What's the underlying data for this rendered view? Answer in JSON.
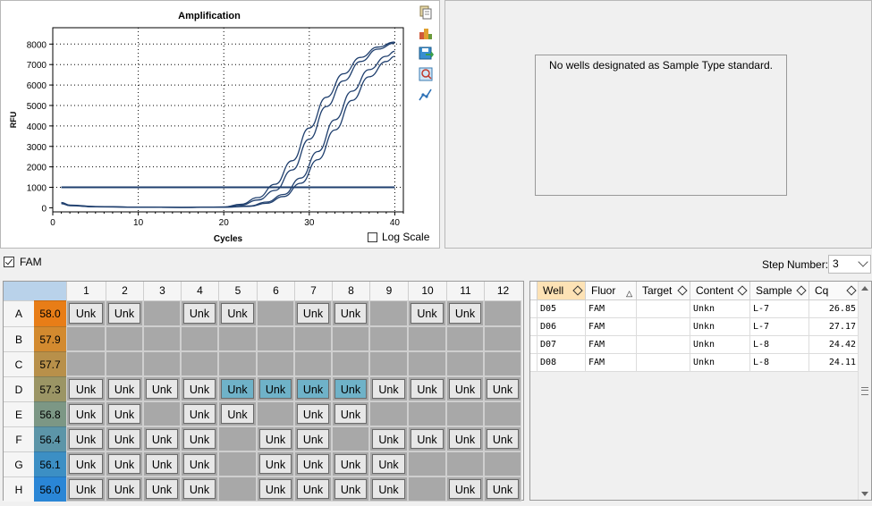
{
  "chart": {
    "title": "Amplification",
    "xlabel": "Cycles",
    "ylabel": "RFU",
    "xticks": [
      0,
      10,
      20,
      30,
      40
    ],
    "yticks": [
      0,
      1000,
      2000,
      3000,
      4000,
      5000,
      6000,
      7000,
      8000
    ],
    "log_scale_label": "Log Scale",
    "log_scale_checked": false
  },
  "chart_data": {
    "type": "line",
    "title": "Amplification",
    "xlabel": "Cycles",
    "ylabel": "RFU",
    "xlim": [
      0,
      41
    ],
    "ylim": [
      -200,
      8800
    ],
    "threshold": 1000,
    "grid": true,
    "series": [
      {
        "well": "D05",
        "values": [
          [
            1,
            260
          ],
          [
            2,
            130
          ],
          [
            5,
            60
          ],
          [
            10,
            30
          ],
          [
            15,
            20
          ],
          [
            20,
            40
          ],
          [
            22,
            170
          ],
          [
            24,
            500
          ],
          [
            26,
            1150
          ],
          [
            28,
            2300
          ],
          [
            30,
            3900
          ],
          [
            32,
            5400
          ],
          [
            34,
            6550
          ],
          [
            36,
            7350
          ],
          [
            38,
            7850
          ],
          [
            40,
            8100
          ]
        ]
      },
      {
        "well": "D06",
        "values": [
          [
            1,
            240
          ],
          [
            2,
            120
          ],
          [
            5,
            55
          ],
          [
            10,
            30
          ],
          [
            15,
            20
          ],
          [
            20,
            40
          ],
          [
            22,
            130
          ],
          [
            24,
            380
          ],
          [
            26,
            850
          ],
          [
            28,
            1850
          ],
          [
            30,
            3350
          ],
          [
            32,
            4950
          ],
          [
            34,
            6200
          ],
          [
            36,
            7150
          ],
          [
            38,
            7750
          ],
          [
            40,
            8050
          ]
        ]
      },
      {
        "well": "D07",
        "values": [
          [
            1,
            200
          ],
          [
            2,
            100
          ],
          [
            5,
            50
          ],
          [
            10,
            30
          ],
          [
            15,
            20
          ],
          [
            20,
            25
          ],
          [
            23,
            70
          ],
          [
            25,
            220
          ],
          [
            27,
            550
          ],
          [
            29,
            1200
          ],
          [
            31,
            2350
          ],
          [
            33,
            3800
          ],
          [
            35,
            5250
          ],
          [
            37,
            6400
          ],
          [
            39,
            7150
          ],
          [
            40,
            7400
          ]
        ]
      },
      {
        "well": "D08",
        "values": [
          [
            1,
            220
          ],
          [
            2,
            110
          ],
          [
            5,
            50
          ],
          [
            10,
            30
          ],
          [
            15,
            20
          ],
          [
            20,
            25
          ],
          [
            23,
            90
          ],
          [
            25,
            280
          ],
          [
            27,
            650
          ],
          [
            29,
            1450
          ],
          [
            31,
            2750
          ],
          [
            33,
            4300
          ],
          [
            35,
            5700
          ],
          [
            37,
            6750
          ],
          [
            39,
            7400
          ],
          [
            40,
            7650
          ]
        ]
      }
    ]
  },
  "std_curve": {
    "message": "No wells designated as Sample Type standard."
  },
  "fluor": {
    "label": "FAM",
    "checked": true
  },
  "step": {
    "label": "Step Number:",
    "value": "3"
  },
  "plate": {
    "columns": [
      "1",
      "2",
      "3",
      "4",
      "5",
      "6",
      "7",
      "8",
      "9",
      "10",
      "11",
      "12"
    ],
    "rows": [
      {
        "label": "A",
        "temp": "58.0",
        "color": "#e87d17",
        "wells": [
          "Unk",
          "Unk",
          "",
          "Unk",
          "Unk",
          "",
          "Unk",
          "Unk",
          "",
          "Unk",
          "Unk",
          ""
        ]
      },
      {
        "label": "B",
        "temp": "57.9",
        "color": "#d38a2f",
        "wells": [
          "",
          "",
          "",
          "",
          "",
          "",
          "",
          "",
          "",
          "",
          "",
          ""
        ]
      },
      {
        "label": "C",
        "temp": "57.7",
        "color": "#b8904a",
        "wells": [
          "",
          "",
          "",
          "",
          "",
          "",
          "",
          "",
          "",
          "",
          "",
          ""
        ]
      },
      {
        "label": "D",
        "temp": "57.3",
        "color": "#9b9565",
        "wells": [
          "Unk",
          "Unk",
          "Unk",
          "Unk",
          "Unk",
          "Unk",
          "Unk",
          "Unk",
          "Unk",
          "Unk",
          "Unk",
          "Unk"
        ],
        "selected": [
          4,
          5,
          6,
          7
        ]
      },
      {
        "label": "E",
        "temp": "56.8",
        "color": "#7c9785",
        "wells": [
          "Unk",
          "Unk",
          "",
          "Unk",
          "Unk",
          "",
          "Unk",
          "Unk",
          "",
          "",
          "",
          ""
        ]
      },
      {
        "label": "F",
        "temp": "56.4",
        "color": "#5c95a8",
        "wells": [
          "Unk",
          "Unk",
          "Unk",
          "Unk",
          "",
          "Unk",
          "Unk",
          "",
          "Unk",
          "Unk",
          "Unk",
          "Unk"
        ]
      },
      {
        "label": "G",
        "temp": "56.1",
        "color": "#3c8fc4",
        "wells": [
          "Unk",
          "Unk",
          "Unk",
          "Unk",
          "",
          "Unk",
          "Unk",
          "Unk",
          "Unk",
          "",
          "",
          ""
        ]
      },
      {
        "label": "H",
        "temp": "56.0",
        "color": "#2a86d6",
        "wells": [
          "Unk",
          "Unk",
          "Unk",
          "Unk",
          "",
          "Unk",
          "Unk",
          "Unk",
          "Unk",
          "",
          "Unk",
          "Unk"
        ]
      }
    ]
  },
  "table": {
    "columns": [
      "Well",
      "Fluor",
      "Target",
      "Content",
      "Sample",
      "Cq"
    ],
    "rows": [
      {
        "well": "D05",
        "fluor": "FAM",
        "target": "",
        "content": "Unkn",
        "sample": "L-7",
        "cq": "26.85"
      },
      {
        "well": "D06",
        "fluor": "FAM",
        "target": "",
        "content": "Unkn",
        "sample": "L-7",
        "cq": "27.17"
      },
      {
        "well": "D07",
        "fluor": "FAM",
        "target": "",
        "content": "Unkn",
        "sample": "L-8",
        "cq": "24.42"
      },
      {
        "well": "D08",
        "fluor": "FAM",
        "target": "",
        "content": "Unkn",
        "sample": "L-8",
        "cq": "24.11"
      }
    ]
  },
  "colors": {
    "curve": "#1f3f6e",
    "threshold": "#1f3f6e",
    "selected_well": "#6fb2c8",
    "active_header": "#fde2b5"
  },
  "icons": [
    "copy-icon",
    "export-icon",
    "save-icon",
    "zoom-icon",
    "chart-settings-icon"
  ]
}
